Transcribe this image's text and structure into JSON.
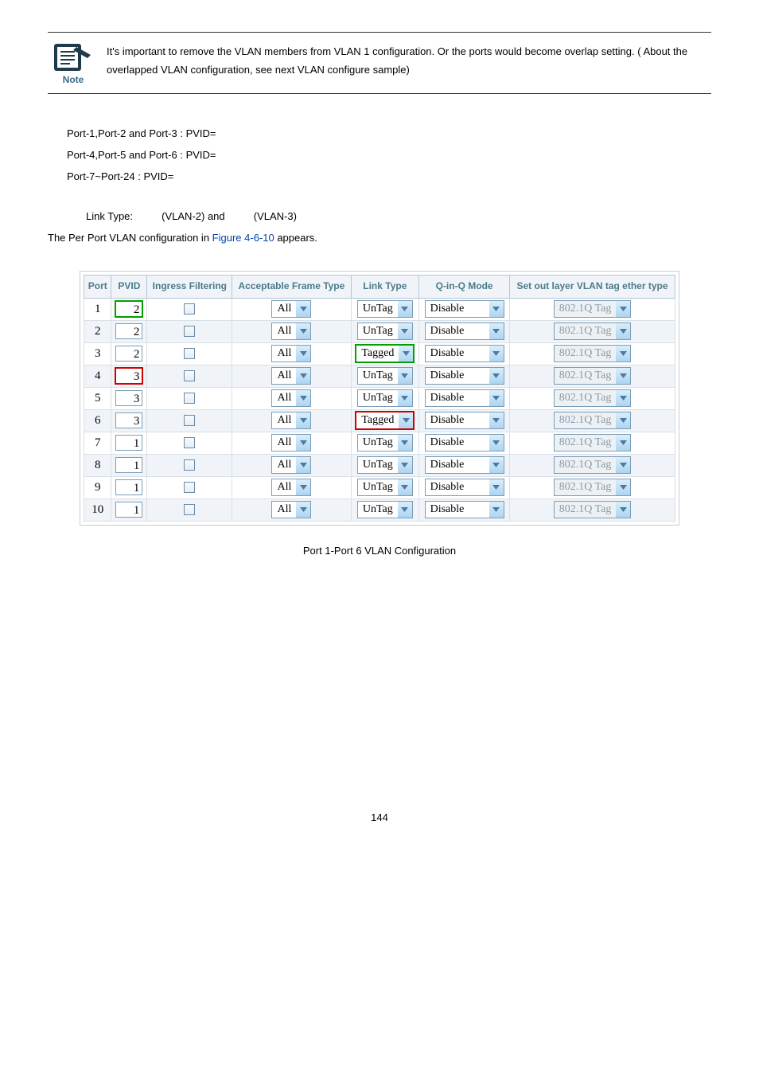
{
  "note": {
    "label": "Note",
    "text": "It's important to remove the VLAN members from VLAN 1 configuration. Or the ports would become overlap setting. ( About the overlapped VLAN configuration, see next VLAN configure sample)"
  },
  "pvid_lines": [
    "Port-1,Port-2 and Port-3 : PVID=",
    "Port-4,Port-5 and Port-6 : PVID=",
    "Port-7~Port-24 : PVID="
  ],
  "link_type_line": {
    "label": "Link Type:",
    "part1": "(VLAN-2) and",
    "part2": "(VLAN-3)"
  },
  "config_line": {
    "prefix": "The Per Port VLAN configuration in ",
    "figref": "Figure 4-6-10",
    "suffix": " appears."
  },
  "headers": {
    "port": "Port",
    "pvid": "PVID",
    "ingress": "Ingress Filtering",
    "frame": "Acceptable Frame Type",
    "linktype": "Link Type",
    "qinq": "Q-in-Q Mode",
    "ether": "Set out layer VLAN tag ether type"
  },
  "rows": [
    {
      "port": "1",
      "pvid": "2",
      "pvid_hl": "green",
      "frame": "All",
      "link": "UnTag",
      "link_hl": "",
      "qinq": "Disable",
      "ether": "802.1Q Tag"
    },
    {
      "port": "2",
      "pvid": "2",
      "pvid_hl": "",
      "frame": "All",
      "link": "UnTag",
      "link_hl": "",
      "qinq": "Disable",
      "ether": "802.1Q Tag"
    },
    {
      "port": "3",
      "pvid": "2",
      "pvid_hl": "",
      "frame": "All",
      "link": "Tagged",
      "link_hl": "green",
      "qinq": "Disable",
      "ether": "802.1Q Tag"
    },
    {
      "port": "4",
      "pvid": "3",
      "pvid_hl": "red",
      "frame": "All",
      "link": "UnTag",
      "link_hl": "",
      "qinq": "Disable",
      "ether": "802.1Q Tag"
    },
    {
      "port": "5",
      "pvid": "3",
      "pvid_hl": "",
      "frame": "All",
      "link": "UnTag",
      "link_hl": "",
      "qinq": "Disable",
      "ether": "802.1Q Tag"
    },
    {
      "port": "6",
      "pvid": "3",
      "pvid_hl": "",
      "frame": "All",
      "link": "Tagged",
      "link_hl": "red-dashed",
      "qinq": "Disable",
      "ether": "802.1Q Tag"
    },
    {
      "port": "7",
      "pvid": "1",
      "pvid_hl": "",
      "frame": "All",
      "link": "UnTag",
      "link_hl": "",
      "qinq": "Disable",
      "ether": "802.1Q Tag"
    },
    {
      "port": "8",
      "pvid": "1",
      "pvid_hl": "",
      "frame": "All",
      "link": "UnTag",
      "link_hl": "",
      "qinq": "Disable",
      "ether": "802.1Q Tag"
    },
    {
      "port": "9",
      "pvid": "1",
      "pvid_hl": "",
      "frame": "All",
      "link": "UnTag",
      "link_hl": "",
      "qinq": "Disable",
      "ether": "802.1Q Tag"
    },
    {
      "port": "10",
      "pvid": "1",
      "pvid_hl": "",
      "frame": "All",
      "link": "UnTag",
      "link_hl": "",
      "qinq": "Disable",
      "ether": "802.1Q Tag"
    }
  ],
  "caption": "Port 1-Port 6 VLAN Configuration",
  "page_number": "144"
}
